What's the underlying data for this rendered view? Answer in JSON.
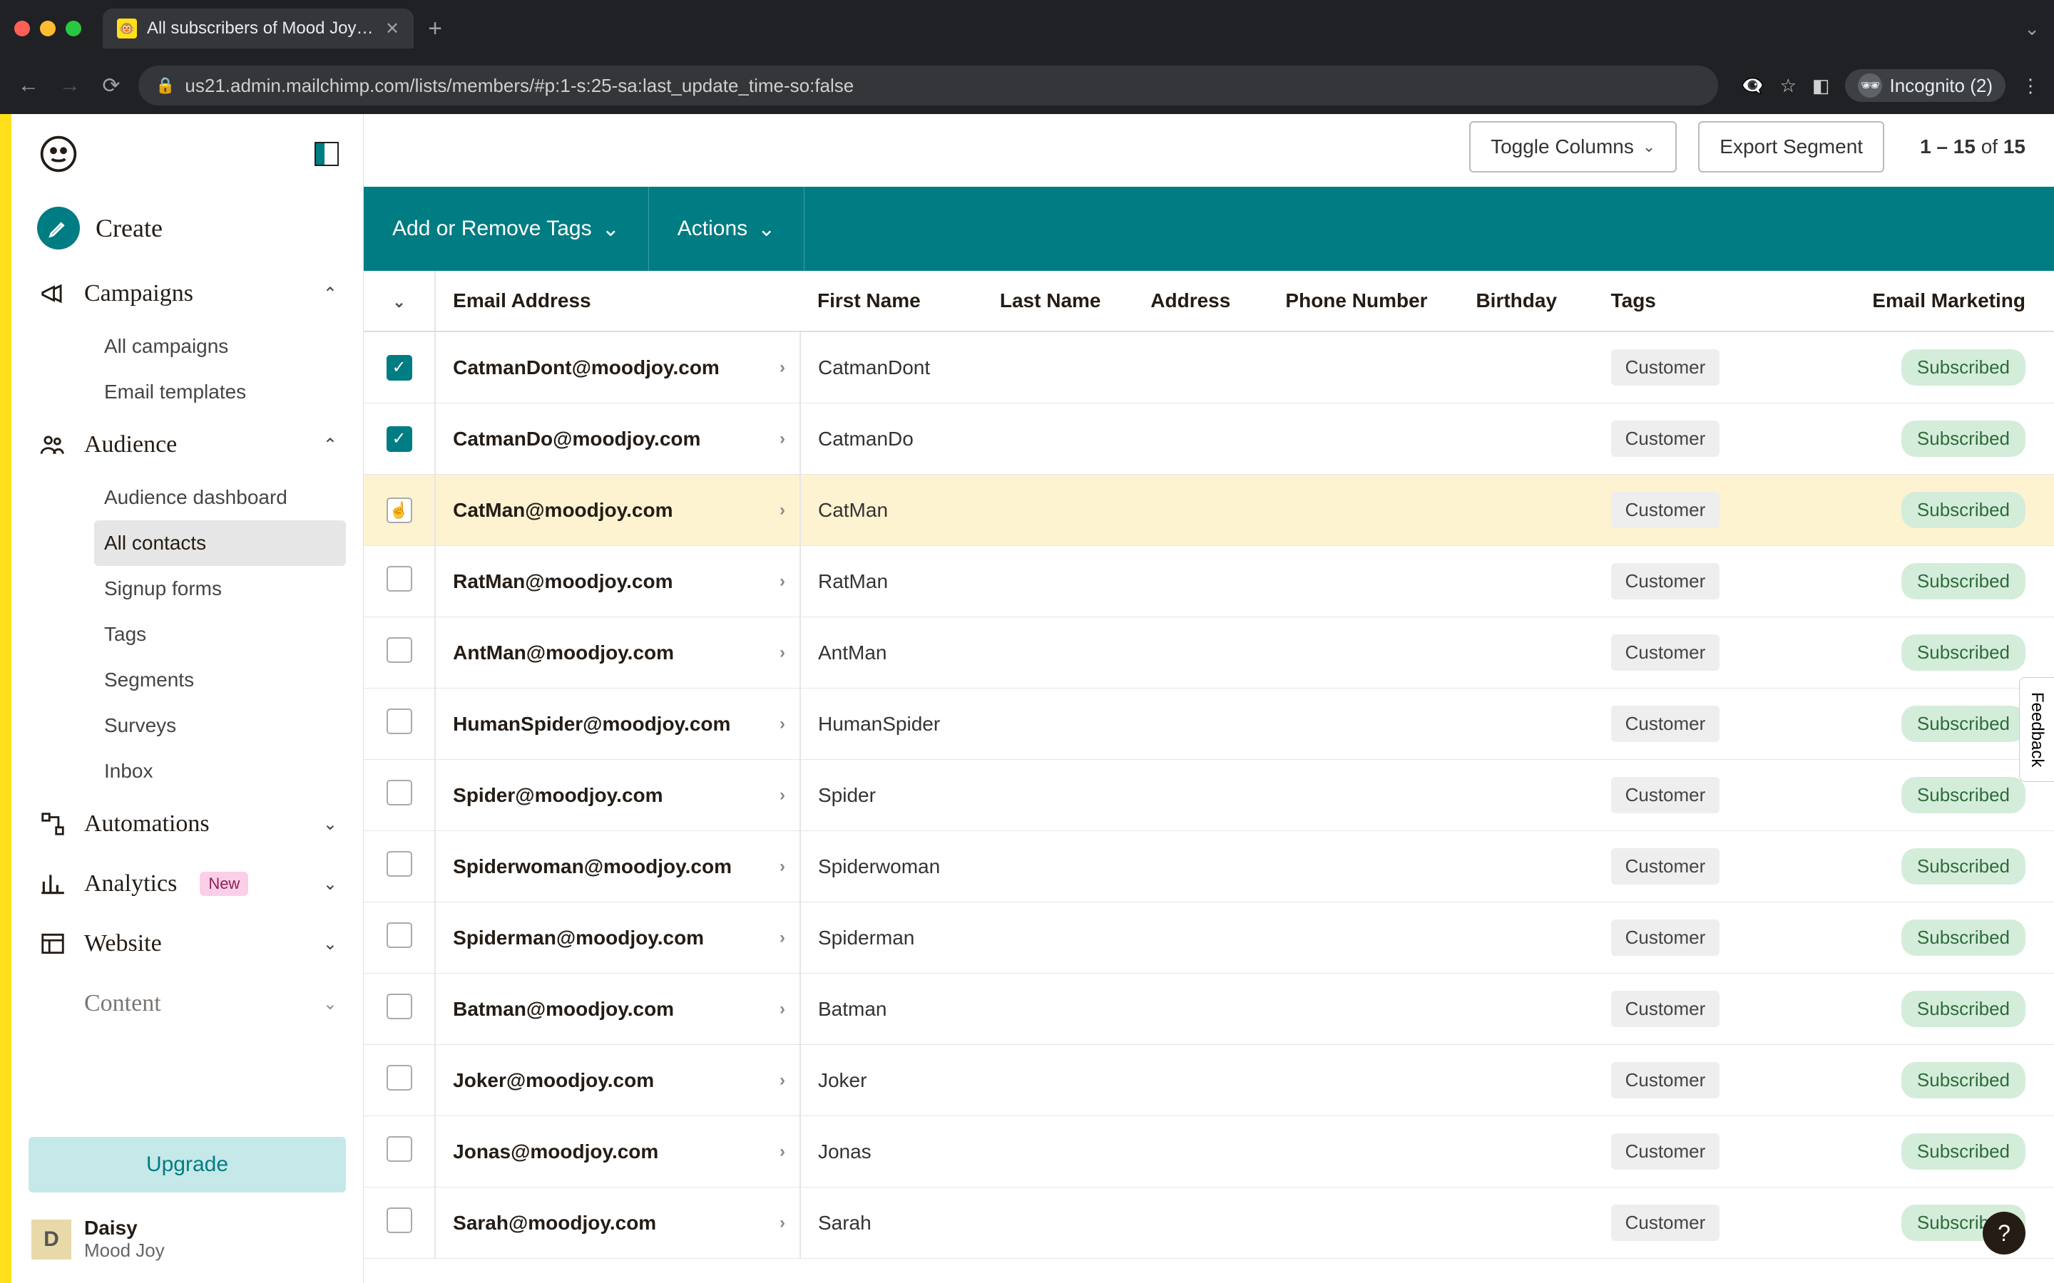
{
  "browser": {
    "tab_title": "All subscribers of Mood Joy | M",
    "url": "us21.admin.mailchimp.com/lists/members/#p:1-s:25-sa:last_update_time-so:false",
    "incognito_label": "Incognito (2)"
  },
  "sidebar": {
    "create_label": "Create",
    "campaigns": {
      "label": "Campaigns",
      "items": [
        "All campaigns",
        "Email templates"
      ]
    },
    "audience": {
      "label": "Audience",
      "items": [
        "Audience dashboard",
        "All contacts",
        "Signup forms",
        "Tags",
        "Segments",
        "Surveys",
        "Inbox"
      ],
      "active": "All contacts"
    },
    "automations": {
      "label": "Automations"
    },
    "analytics": {
      "label": "Analytics",
      "badge": "New"
    },
    "website": {
      "label": "Website"
    },
    "content": {
      "label": "Content"
    },
    "upgrade": "Upgrade",
    "user": {
      "initial": "D",
      "name": "Daisy",
      "org": "Mood Joy"
    }
  },
  "toolbar": {
    "toggle_columns": "Toggle Columns",
    "export_segment": "Export Segment",
    "pager_range": "1 – 15",
    "pager_of": "of",
    "pager_total": "15",
    "add_remove_tags": "Add or Remove Tags",
    "actions": "Actions"
  },
  "columns": {
    "email": "Email Address",
    "first_name": "First Name",
    "last_name": "Last Name",
    "address": "Address",
    "phone": "Phone Number",
    "birthday": "Birthday",
    "tags": "Tags",
    "email_marketing": "Email Marketing"
  },
  "rows": [
    {
      "checked": true,
      "highlight": false,
      "email": "CatmanDont@moodjoy.com",
      "first_name": "CatmanDont",
      "tag": "Customer",
      "status": "Subscribed"
    },
    {
      "checked": true,
      "highlight": false,
      "email": "CatmanDo@moodjoy.com",
      "first_name": "CatmanDo",
      "tag": "Customer",
      "status": "Subscribed"
    },
    {
      "checked": false,
      "highlight": true,
      "email": "CatMan@moodjoy.com",
      "first_name": "CatMan",
      "tag": "Customer",
      "status": "Subscribed"
    },
    {
      "checked": false,
      "highlight": false,
      "email": "RatMan@moodjoy.com",
      "first_name": "RatMan",
      "tag": "Customer",
      "status": "Subscribed"
    },
    {
      "checked": false,
      "highlight": false,
      "email": "AntMan@moodjoy.com",
      "first_name": "AntMan",
      "tag": "Customer",
      "status": "Subscribed"
    },
    {
      "checked": false,
      "highlight": false,
      "email": "HumanSpider@moodjoy.com",
      "first_name": "HumanSpider",
      "tag": "Customer",
      "status": "Subscribed"
    },
    {
      "checked": false,
      "highlight": false,
      "email": "Spider@moodjoy.com",
      "first_name": "Spider",
      "tag": "Customer",
      "status": "Subscribed"
    },
    {
      "checked": false,
      "highlight": false,
      "email": "Spiderwoman@moodjoy.com",
      "first_name": "Spiderwoman",
      "tag": "Customer",
      "status": "Subscribed"
    },
    {
      "checked": false,
      "highlight": false,
      "email": "Spiderman@moodjoy.com",
      "first_name": "Spiderman",
      "tag": "Customer",
      "status": "Subscribed"
    },
    {
      "checked": false,
      "highlight": false,
      "email": "Batman@moodjoy.com",
      "first_name": "Batman",
      "tag": "Customer",
      "status": "Subscribed"
    },
    {
      "checked": false,
      "highlight": false,
      "email": "Joker@moodjoy.com",
      "first_name": "Joker",
      "tag": "Customer",
      "status": "Subscribed"
    },
    {
      "checked": false,
      "highlight": false,
      "email": "Jonas@moodjoy.com",
      "first_name": "Jonas",
      "tag": "Customer",
      "status": "Subscribed"
    },
    {
      "checked": false,
      "highlight": false,
      "email": "Sarah@moodjoy.com",
      "first_name": "Sarah",
      "tag": "Customer",
      "status": "Subscribed"
    }
  ],
  "feedback_label": "Feedback",
  "help_label": "?"
}
